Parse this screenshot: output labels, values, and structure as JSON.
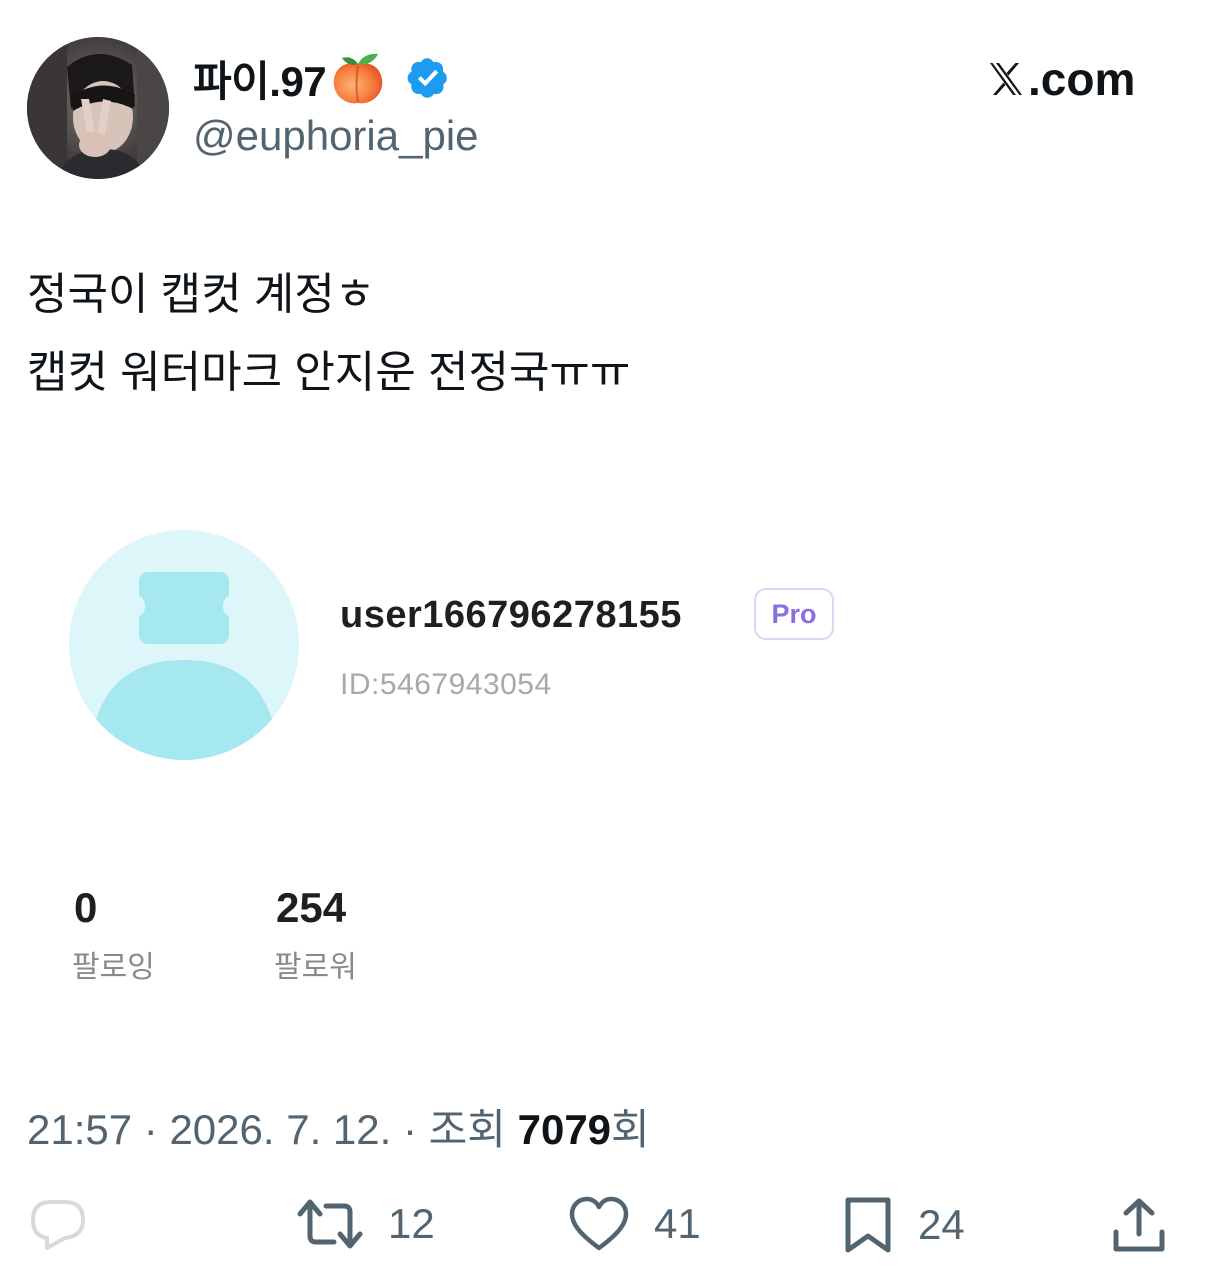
{
  "author": {
    "display_name": "파이.97",
    "handle": "@euphoria_pie"
  },
  "brand": {
    "site": ".com"
  },
  "tweet": {
    "lines": [
      "정국이 캡컷 계정ㅎ",
      "캡컷 워터마크 안지운 전정국ㅠㅠ"
    ]
  },
  "media": {
    "username": "user166796278155",
    "badge": "Pro",
    "user_id": "ID:5467943054",
    "following_count": "0",
    "following_label": "팔로잉",
    "followers_count": "254",
    "followers_label": "팔로워"
  },
  "meta": {
    "time": "21:57",
    "date": "2026. 7. 12.",
    "separator": "·",
    "views_prefix": "조회",
    "views": "7079",
    "views_suffix": "회"
  },
  "actions": {
    "reply": {
      "icon": "reply-icon",
      "count": ""
    },
    "retweet": {
      "icon": "retweet-icon",
      "count": "12"
    },
    "like": {
      "icon": "heart-icon",
      "count": "41"
    },
    "bookmark": {
      "icon": "bookmark-icon",
      "count": "24"
    },
    "share": {
      "icon": "share-icon"
    }
  },
  "colors": {
    "verified": "#1d9bf0",
    "secondary_text": "#536471",
    "pro_badge": "#8a6fe0",
    "avatar_placeholder": "#a6e8ef"
  }
}
